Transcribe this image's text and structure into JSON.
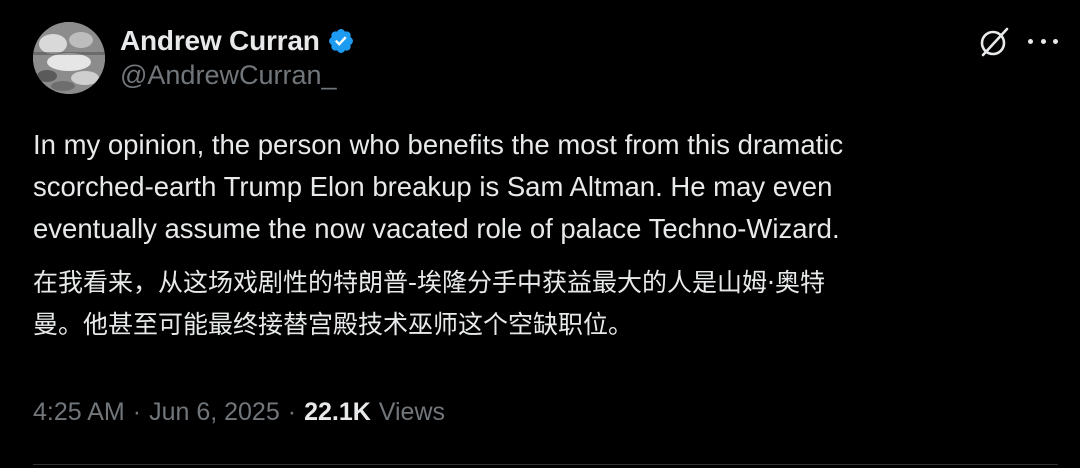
{
  "author": {
    "display_name": "Andrew Curran",
    "handle": "@AndrewCurran_",
    "verified_color": "#1d9bf0"
  },
  "icons": {
    "avatar": "profile-photo",
    "verified": "verified-badge-icon",
    "grok": "grok-icon",
    "more": "more-options-icon"
  },
  "tweet": {
    "text": "In my opinion, the person who benefits the most from this dramatic\nscorched-earth Trump Elon breakup is Sam Altman. He may even\neventually assume the now vacated role of palace Techno-Wizard.",
    "translation": "在我看来，从这场戏剧性的特朗普-埃隆分手中获益最大的人是山姆·奥特\n曼。他甚至可能最终接替宫殿技术巫师这个空缺职位。"
  },
  "meta": {
    "time": "4:25 AM",
    "separator": "·",
    "date": "Jun 6, 2025",
    "views_count": "22.1K",
    "views_label": "Views"
  },
  "colors": {
    "background": "#000000",
    "primary_text": "#e7e9ea",
    "secondary_text": "#71767b",
    "divider": "#2f3336"
  }
}
